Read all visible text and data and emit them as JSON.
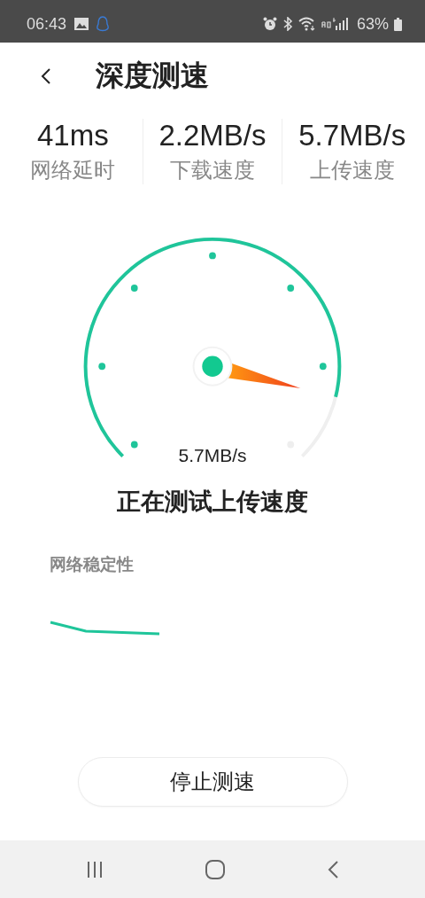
{
  "status_bar": {
    "time": "06:43",
    "battery": "63%"
  },
  "header": {
    "title": "深度测速"
  },
  "stats": [
    {
      "value": "41ms",
      "label": "网络延时"
    },
    {
      "value": "2.2MB/s",
      "label": "下载速度"
    },
    {
      "value": "5.7MB/s",
      "label": "上传速度"
    }
  ],
  "gauge": {
    "reading": "5.7MB/s"
  },
  "status_text": "正在测试上传速度",
  "stability": {
    "label": "网络稳定性"
  },
  "stop_button": "停止测速"
}
